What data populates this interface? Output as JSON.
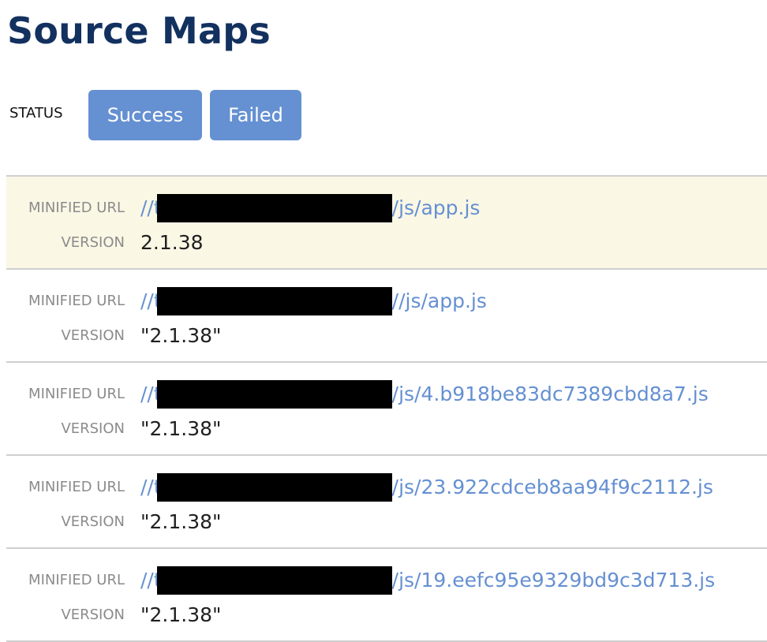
{
  "page": {
    "title": "Source Maps"
  },
  "filters": {
    "label": "STATUS",
    "buttons": [
      {
        "label": "Success"
      },
      {
        "label": "Failed"
      }
    ],
    "button_color": "#6590d2"
  },
  "columns": {
    "url_label": "MINIFIED URL",
    "version_label": "VERSION"
  },
  "rows": [
    {
      "url_prefix": "//t",
      "url_suffix": "/js/app.js",
      "version": "2.1.38",
      "highlighted": true
    },
    {
      "url_prefix": "//t",
      "url_suffix": "//js/app.js",
      "version": "\"2.1.38\"",
      "highlighted": false
    },
    {
      "url_prefix": "//t",
      "url_suffix": "/js/4.b918be83dc7389cbd8a7.js",
      "version": "\"2.1.38\"",
      "highlighted": false
    },
    {
      "url_prefix": "//t",
      "url_suffix": "/js/23.922cdceb8aa94f9c2112.js",
      "version": "\"2.1.38\"",
      "highlighted": false
    },
    {
      "url_prefix": "//t",
      "url_suffix": "/js/19.eefc95e9329bd9c3d713.js",
      "version": "\"2.1.38\"",
      "highlighted": false
    }
  ],
  "colors": {
    "title": "#13315f",
    "link": "#6590d2",
    "highlight_bg": "#faf7e5",
    "redaction": "#000000"
  }
}
